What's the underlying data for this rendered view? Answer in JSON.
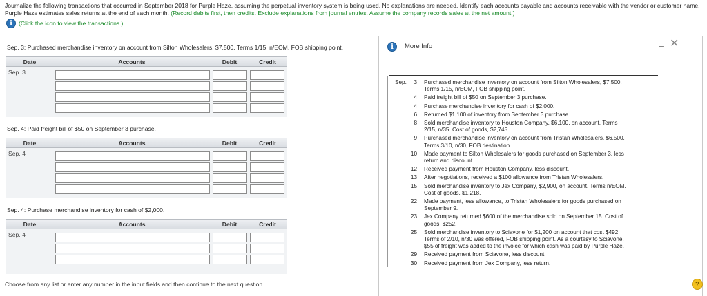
{
  "instructions": {
    "main": "Journalize the following transactions that occurred in September 2018 for Purple Haze, assuming the perpetual inventory system is being used. No explanations are needed. Identify each accounts payable and accounts receivable with the vendor or customer name. Purple Haze estimates sales returns at the end of each month.",
    "green": "(Record debits first, then credits. Exclude explanations from journal entries. Assume the company records sales at the net amount.)",
    "icon_hint": "(Click the icon to view the transactions.)"
  },
  "journal": {
    "headers": {
      "date": "Date",
      "accounts": "Accounts",
      "debit": "Debit",
      "credit": "Credit"
    },
    "entries": [
      {
        "question": "Sep. 3: Purchased merchandise inventory on account from Silton Wholesalers, $7,500. Terms 1/15, n/EOM, FOB shipping point.",
        "date": "Sep. 3"
      },
      {
        "question": "Sep. 4: Paid freight bill of $50 on September 3 purchase.",
        "date": "Sep. 4"
      },
      {
        "question": "Sep. 4: Purchase merchandise inventory for cash of $2,000.",
        "date": "Sep. 4"
      }
    ]
  },
  "footer": "Choose from any list or enter any number in the input fields and then continue to the next question.",
  "modal": {
    "title": "More Info",
    "minimize": "–",
    "close": "✕",
    "month": "Sep.",
    "transactions": [
      {
        "day": "3",
        "lines": [
          "Purchased merchandise inventory on account from Silton Wholesalers, $7,500.",
          "Terms 1/15, n/EOM, FOB shipping point."
        ]
      },
      {
        "day": "4",
        "lines": [
          "Paid freight bill of $50 on September 3 purchase."
        ]
      },
      {
        "day": "4",
        "lines": [
          "Purchase merchandise inventory for cash of $2,000."
        ]
      },
      {
        "day": "6",
        "lines": [
          "Returned $1,100 of inventory from September 3 purchase."
        ]
      },
      {
        "day": "8",
        "lines": [
          "Sold merchandise inventory to Houston Company, $6,100, on account. Terms",
          "2/15, n/35. Cost of goods, $2,745."
        ]
      },
      {
        "day": "9",
        "lines": [
          "Purchased merchandise inventory on account from Tristan Wholesalers, $6,500.",
          "Terms 3/10, n/30, FOB destination."
        ]
      },
      {
        "day": "10",
        "lines": [
          "Made payment to Silton Wholesalers for goods purchased on September 3, less",
          "return and discount."
        ]
      },
      {
        "day": "12",
        "lines": [
          "Received payment from Houston Company, less discount."
        ]
      },
      {
        "day": "13",
        "lines": [
          "After negotiations, received a $100 allowance from Tristan Wholesalers."
        ]
      },
      {
        "day": "15",
        "lines": [
          "Sold merchandise inventory to Jex Company, $2,900, on account. Terms n/EOM.",
          "Cost of goods, $1,218."
        ]
      },
      {
        "day": "22",
        "lines": [
          "Made payment, less allowance, to Tristan Wholesalers for goods purchased on",
          "September 9."
        ]
      },
      {
        "day": "23",
        "lines": [
          "Jex Company returned $600 of the merchandise sold on September 15. Cost of",
          "goods, $252."
        ]
      },
      {
        "day": "25",
        "lines": [
          "Sold merchandise inventory to Sciavone for $1,200 on account that cost $492.",
          "Terms of 2/10, n/30 was offered, FOB shipping point. As a courtesy to Sciavone,",
          "$55 of freight was added to the invoice for which cash was paid by Purple Haze."
        ]
      },
      {
        "day": "29",
        "lines": [
          "Received payment from Sciavone, less discount."
        ]
      },
      {
        "day": "30",
        "lines": [
          "Received payment from Jex Company, less return."
        ]
      }
    ]
  },
  "help": "?",
  "info_glyph": "i",
  "colors": {
    "green": "#1a8a2a",
    "info_blue": "#2b73b9",
    "help_yellow": "#f2c01f"
  }
}
